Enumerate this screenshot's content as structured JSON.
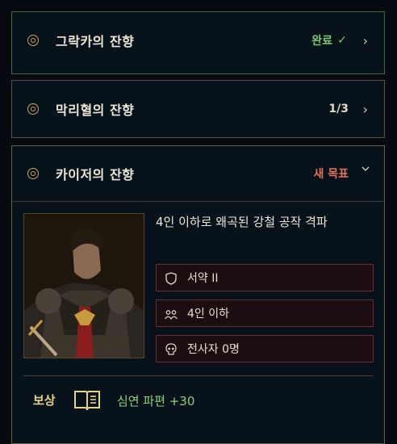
{
  "quests": [
    {
      "title": "그락카의 잔향",
      "status": "완료",
      "status_mark": "✓",
      "chevron": "›"
    },
    {
      "title": "막리혈의 잔향",
      "status": "1/3",
      "chevron": "›"
    },
    {
      "title": "카이저의 잔향",
      "status": "새 목표",
      "chevron": "chevron-down"
    }
  ],
  "detail": {
    "objective": "4인 이하로 왜곡된 강철 공작 격파",
    "conditions": [
      {
        "icon": "shield-icon",
        "label": "서약 II"
      },
      {
        "icon": "party-icon",
        "label": "4인 이하"
      },
      {
        "icon": "skull-icon",
        "label": "전사자 0명"
      }
    ],
    "reward": {
      "label": "보상",
      "icon": "book-icon",
      "value": "심연 파편 +30"
    }
  },
  "colors": {
    "done": "#7fc56f",
    "new": "#e0705a",
    "accent_gold": "#c9a45a",
    "condition_border": "#6a2a2c"
  }
}
